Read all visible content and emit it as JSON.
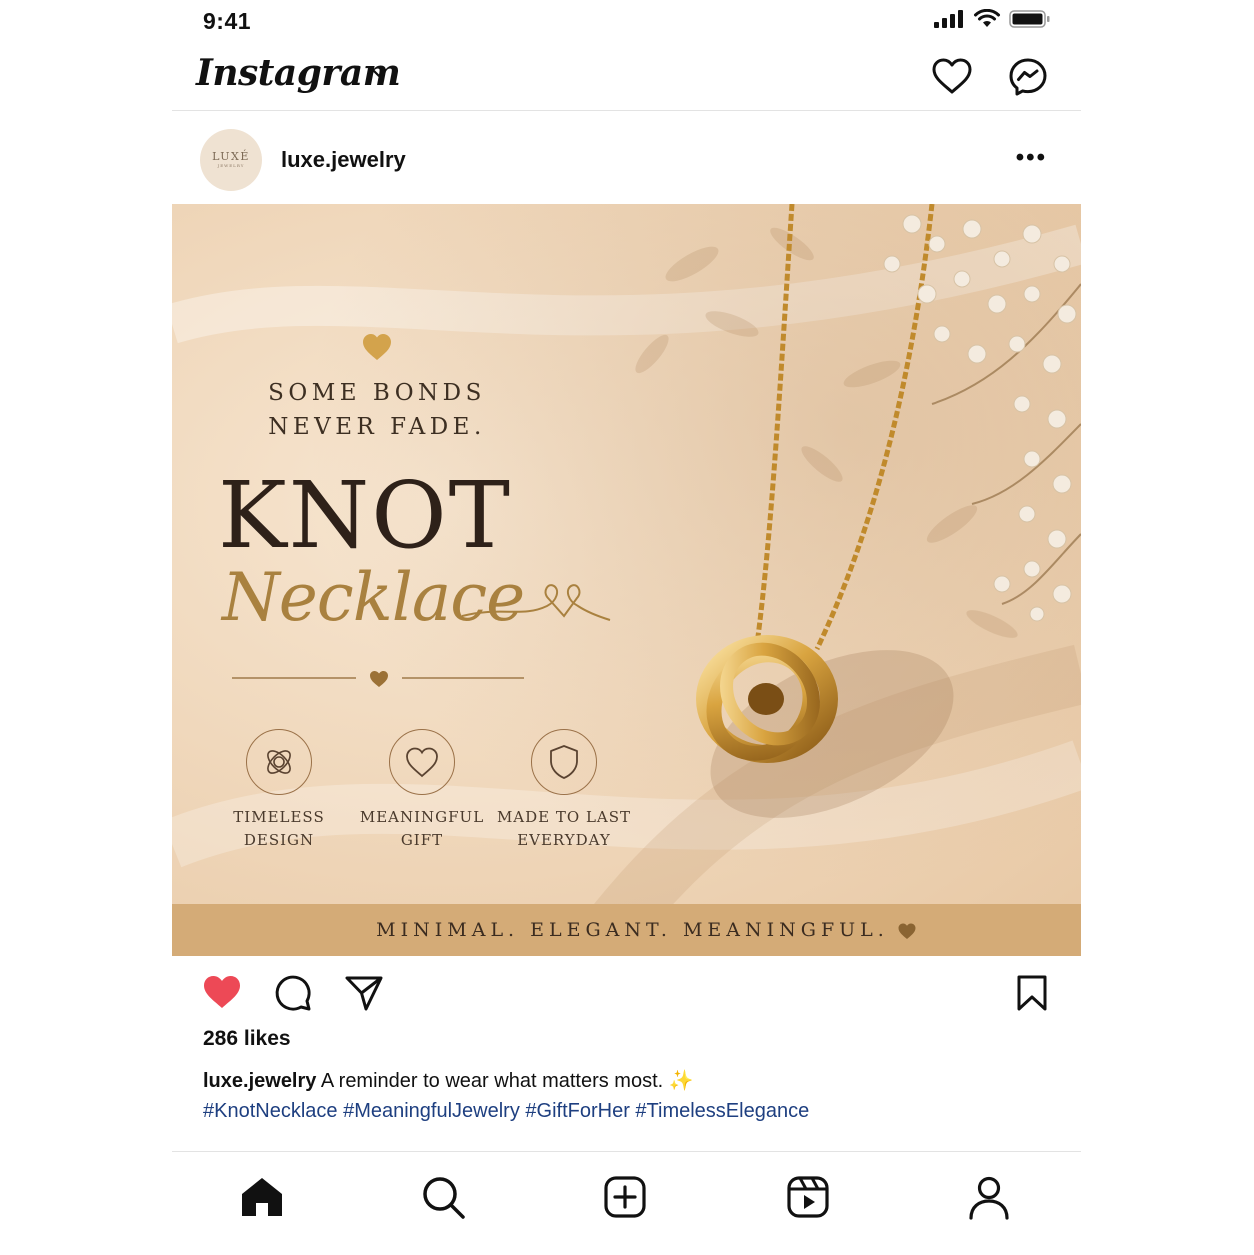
{
  "status_bar": {
    "time": "9:41"
  },
  "header": {
    "app_name": "Instagram"
  },
  "post": {
    "username": "luxe.jewelry",
    "avatar": {
      "brand": "LUXÉ",
      "sub": "JEWELRY"
    },
    "image": {
      "tagline_line1": "SOME BONDS",
      "tagline_line2": "NEVER FADE.",
      "title": "KNOT",
      "script_title": "Necklace",
      "features": [
        {
          "line1": "TIMELESS",
          "line2": "DESIGN",
          "icon": "knot-icon"
        },
        {
          "line1": "MEANINGFUL",
          "line2": "GIFT",
          "icon": "heart-outline-icon"
        },
        {
          "line1": "MADE TO LAST",
          "line2": "EVERYDAY",
          "icon": "shield-icon"
        }
      ],
      "banner": "MINIMAL. ELEGANT. MEANINGFUL."
    },
    "likes": "286 likes",
    "caption_user": "luxe.jewelry",
    "caption_text": "A reminder to wear what matters most. ✨",
    "hashtags": "#KnotNecklace #MeaningfulJewelry #GiftForHer #TimelessElegance"
  },
  "colors": {
    "like_red": "#ed4956",
    "gold": "#c9a25e",
    "banner": "#d4ab77",
    "hashtag_blue": "#1e3f80"
  },
  "bottom_nav": [
    "home-icon",
    "search-icon",
    "new-post-icon",
    "reels-icon",
    "profile-icon"
  ]
}
